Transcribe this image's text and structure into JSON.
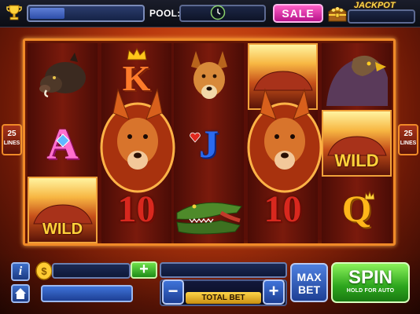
{
  "header": {
    "pool_label": "POOL:",
    "sale_label": "SALE",
    "jackpot_label": "JACKPOT"
  },
  "lines": {
    "count": "25",
    "unit": "LINES"
  },
  "reels": [
    [
      "boar",
      "ace",
      "wild-rock"
    ],
    [
      "king",
      "kangaroo",
      "ten"
    ],
    [
      "dingo",
      "jack",
      "crocodile"
    ],
    [
      "wild-rock",
      "kangaroo",
      "ten"
    ],
    [
      "eagle",
      "wild-rock",
      "queen"
    ]
  ],
  "symbols": {
    "king_letter": "K",
    "ace_letter": "A",
    "jack_letter": "J",
    "queen_letter": "Q",
    "ten_label": "10",
    "wild_label": "WILD"
  },
  "controls": {
    "info_label": "i",
    "buy_plus_label": "+",
    "bet_minus_label": "−",
    "bet_plus_label": "+",
    "total_bet_label": "TOTAL BET",
    "max_bet_line1": "MAX",
    "max_bet_line2": "BET",
    "spin_label": "SPIN",
    "spin_sub_label": "HOLD FOR AUTO"
  },
  "colors": {
    "accent_orange": "#f08a28",
    "spin_green": "#2da51d",
    "sale_pink": "#e0299f",
    "button_blue": "#2d55b8"
  }
}
